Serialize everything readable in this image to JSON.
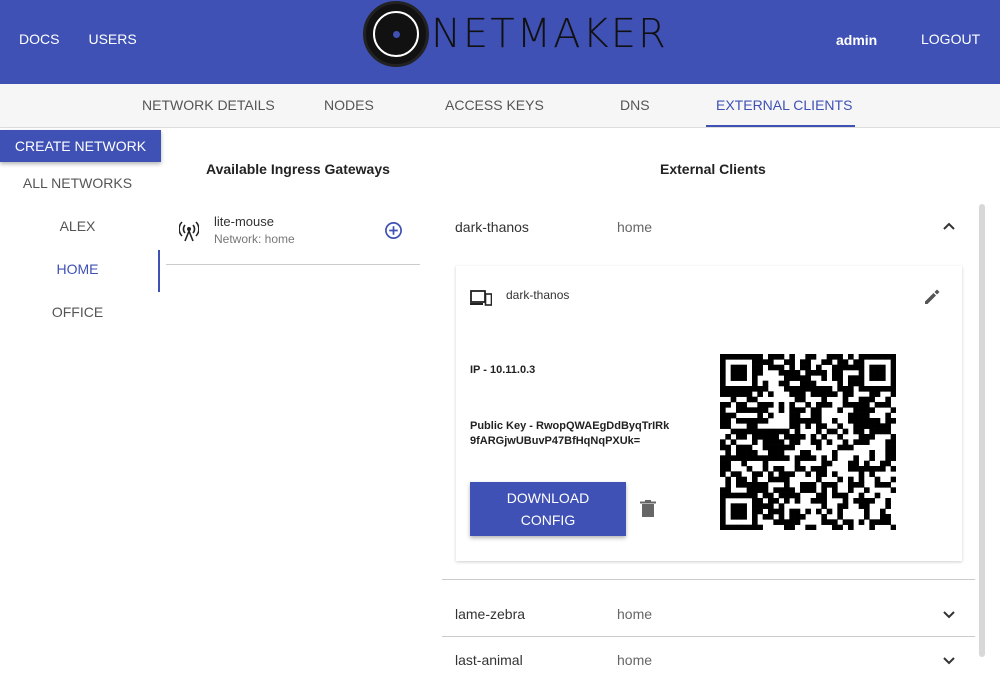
{
  "header": {
    "nav_links": [
      "DOCS",
      "USERS"
    ],
    "brand": "NETMAKER",
    "user": "admin",
    "logout": "LOGOUT",
    "background_color": "#3f51b5"
  },
  "tabs": [
    "NETWORK DETAILS",
    "NODES",
    "ACCESS KEYS",
    "DNS",
    "EXTERNAL CLIENTS"
  ],
  "active_tab": "EXTERNAL CLIENTS",
  "sidebar": {
    "create_button": "CREATE NETWORK",
    "items": [
      "ALL NETWORKS",
      "ALEX",
      "HOME",
      "OFFICE"
    ],
    "active": "HOME"
  },
  "gateways": {
    "title": "Available Ingress Gateways",
    "items": [
      {
        "name": "lite-mouse",
        "network": "Network: home",
        "icon": "antenna-icon",
        "action_icon": "add-circle-icon"
      }
    ]
  },
  "clients": {
    "title": "External Clients",
    "items": [
      {
        "name": "dark-thanos",
        "network": "home",
        "expanded": true,
        "detail": {
          "device_name": "dark-thanos",
          "ip": "IP - 10.11.0.3",
          "public_key": "Public Key - RwopQWAEgDdByqTrIRk9fARGjwUBuvP47BfHqNqPXUk=",
          "download_label_1": "DOWNLOAD",
          "download_label_2": "CONFIG"
        }
      },
      {
        "name": "lame-zebra",
        "network": "home",
        "expanded": false
      },
      {
        "name": "last-animal",
        "network": "home",
        "expanded": false
      }
    ]
  }
}
